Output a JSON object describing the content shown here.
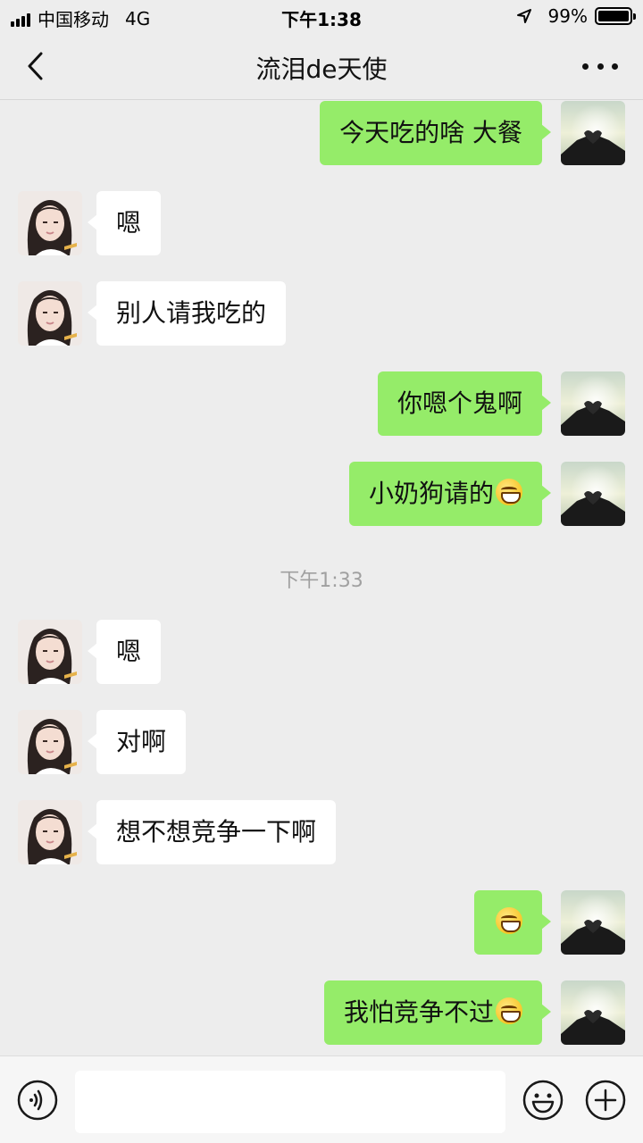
{
  "status_bar": {
    "carrier": "中国移动",
    "network": "4G",
    "time": "下午1:38",
    "battery": "99%",
    "battery_level": 0.99
  },
  "header": {
    "title": "流泪de天使"
  },
  "messages": [
    {
      "side": "out",
      "text": "今天吃的啥 大餐",
      "emoji": ""
    },
    {
      "side": "in",
      "text": "嗯",
      "emoji": ""
    },
    {
      "side": "in",
      "text": "别人请我吃的",
      "emoji": ""
    },
    {
      "side": "out",
      "text": "你嗯个鬼啊",
      "emoji": ""
    },
    {
      "side": "out",
      "text": "小奶狗请的",
      "emoji": "grin-emoji"
    },
    {
      "side": "in",
      "text": "嗯",
      "emoji": ""
    },
    {
      "side": "in",
      "text": "对啊",
      "emoji": ""
    },
    {
      "side": "in",
      "text": "想不想竞争一下啊",
      "emoji": ""
    },
    {
      "side": "out",
      "text": "",
      "emoji": "grin-emoji"
    },
    {
      "side": "out",
      "text": "我怕竞争不过",
      "emoji": "grin-emoji"
    }
  ],
  "timestamp": "下午1:33",
  "input": {
    "value": "",
    "placeholder": ""
  },
  "icons": {
    "back": "chevron-left-icon",
    "more": "more-icon",
    "voice": "voice-icon",
    "emoji": "emoji-icon",
    "plus": "plus-icon"
  },
  "colors": {
    "background": "#ededed",
    "bubble_out": "#95ec69",
    "bubble_in": "#ffffff"
  }
}
